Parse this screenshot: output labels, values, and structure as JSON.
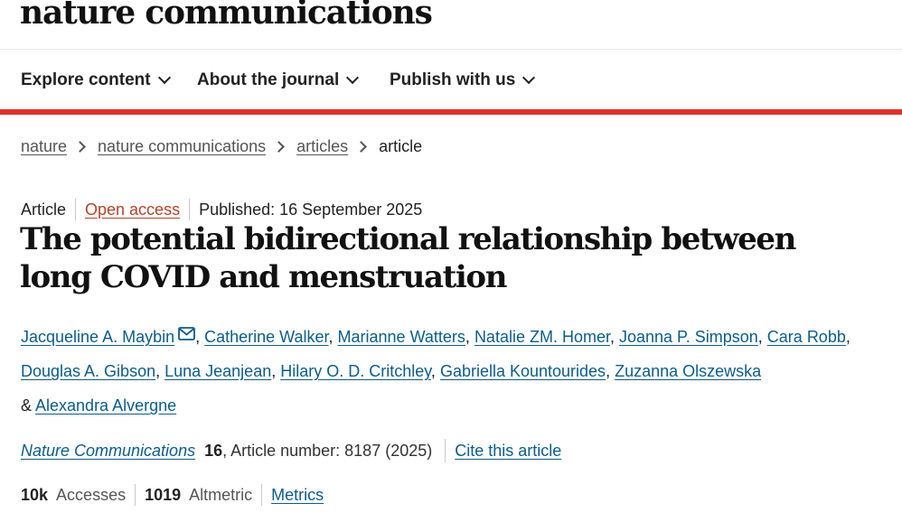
{
  "site": {
    "logo": "nature communications"
  },
  "nav": {
    "items": [
      {
        "label": "Explore content"
      },
      {
        "label": "About the journal"
      },
      {
        "label": "Publish with us"
      }
    ]
  },
  "breadcrumb": {
    "items": [
      {
        "label": "nature"
      },
      {
        "label": "nature communications"
      },
      {
        "label": "articles"
      }
    ],
    "current": "article"
  },
  "article": {
    "type": "Article",
    "access": "Open access",
    "published": "Published: 16 September 2025",
    "title": "The potential bidirectional relationship between long COVID and menstruation",
    "authors": [
      "Jacqueline A. Maybin",
      "Catherine Walker",
      "Marianne Watters",
      "Natalie ZM. Homer",
      "Joanna P. Simpson",
      "Cara Robb",
      "Douglas A. Gibson",
      "Luna Jeanjean",
      "Hilary O. D. Critchley",
      "Gabriella Kountourides",
      "Zuzanna Olszewska",
      "Alexandra Alvergne"
    ],
    "author_separator": ", ",
    "last_author_joiner": "& ",
    "citation": {
      "journal": "Nature Communications",
      "volume": "16",
      "rest": ", Article number: 8187 (2025)",
      "cite_label": "Cite this article"
    },
    "metrics": {
      "accesses_value": "10k",
      "accesses_label": "Accesses",
      "altmetric_value": "1019",
      "altmetric_label": "Altmetric",
      "metrics_link": "Metrics"
    }
  },
  "colors": {
    "accent_red": "#e0302c",
    "link_blue": "#0b5c8b",
    "open_access": "#b4432b"
  }
}
